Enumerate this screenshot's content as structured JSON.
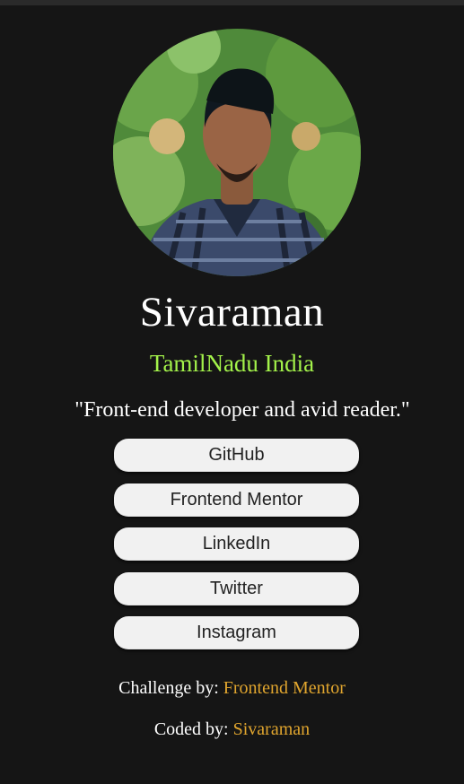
{
  "profile": {
    "name": "Sivaraman",
    "location": "TamilNadu India",
    "bio": "\"Front-end developer and avid reader.\""
  },
  "links": [
    {
      "label": "GitHub"
    },
    {
      "label": "Frontend Mentor"
    },
    {
      "label": "LinkedIn"
    },
    {
      "label": "Twitter"
    },
    {
      "label": "Instagram"
    }
  ],
  "footer": {
    "challenge_prefix": "Challenge by:",
    "challenge_link": "Frontend Mentor",
    "coded_prefix": "Coded by:",
    "coded_link": "Sivaraman"
  },
  "colors": {
    "background": "#151515",
    "location": "#a3f24a",
    "button": "#f1f1f1",
    "footer_link": "#e0a52e"
  }
}
